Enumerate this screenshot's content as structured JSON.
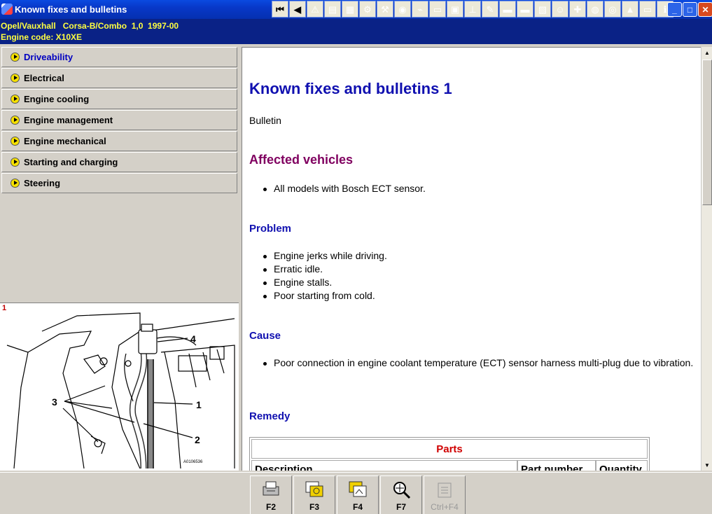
{
  "window": {
    "title": "Known fixes and bulletins",
    "controls": {
      "minimize": "_",
      "maximize": "□",
      "close": "✕"
    }
  },
  "toolbar": {
    "buttons": [
      {
        "name": "first-record-icon",
        "glyph": "⏮"
      },
      {
        "name": "previous-icon",
        "glyph": "◀"
      },
      {
        "name": "warning-icon",
        "glyph": "⚠"
      },
      {
        "name": "document-icon",
        "glyph": "▤"
      },
      {
        "name": "map-icon",
        "glyph": "▦"
      },
      {
        "name": "engine-icon",
        "glyph": "⚙"
      },
      {
        "name": "tools-icon",
        "glyph": "⚒"
      },
      {
        "name": "gauge-icon",
        "glyph": "◉"
      },
      {
        "name": "wiring-icon",
        "glyph": "⌁"
      },
      {
        "name": "car-icon",
        "glyph": "▭"
      },
      {
        "name": "garage-icon",
        "glyph": "▣"
      },
      {
        "name": "lift-icon",
        "glyph": "⊥"
      },
      {
        "name": "repair-icon",
        "glyph": "✎"
      },
      {
        "name": "car-service-icon",
        "glyph": "▬"
      },
      {
        "name": "car-green-icon",
        "glyph": "▬"
      },
      {
        "name": "bulletin-icon",
        "glyph": "▧"
      },
      {
        "name": "smiley-icon",
        "glyph": "☺"
      },
      {
        "name": "diagnostic-icon",
        "glyph": "✚"
      },
      {
        "name": "globe-icon",
        "glyph": "◍"
      },
      {
        "name": "tyre-icon",
        "glyph": "◎"
      },
      {
        "name": "road-sign-icon",
        "glyph": "▲"
      },
      {
        "name": "bus-icon",
        "glyph": "▭"
      },
      {
        "name": "info-icon",
        "glyph": "ℹ"
      }
    ]
  },
  "vehicle": {
    "line1": "Opel/Vauxhall   Corsa-B/Combo  1,0  1997-00",
    "line2": "Engine code: X10XE"
  },
  "nav": {
    "items": [
      {
        "label": "Driveability",
        "active": true
      },
      {
        "label": "Electrical",
        "active": false
      },
      {
        "label": "Engine cooling",
        "active": false
      },
      {
        "label": "Engine management",
        "active": false
      },
      {
        "label": "Engine mechanical",
        "active": false
      },
      {
        "label": "Starting and charging",
        "active": false
      },
      {
        "label": "Steering",
        "active": false
      }
    ]
  },
  "figure": {
    "number": "1",
    "callouts": [
      "1",
      "2",
      "3",
      "4"
    ],
    "reference": "A0106536"
  },
  "document": {
    "title": "Known fixes and bulletins 1",
    "type": "Bulletin",
    "affected_heading": "Affected vehicles",
    "affected_items": [
      "All models with Bosch ECT sensor."
    ],
    "problem_heading": "Problem",
    "problem_items": [
      "Engine jerks while driving.",
      "Erratic idle.",
      "Engine stalls.",
      "Poor starting from cold."
    ],
    "cause_heading": "Cause",
    "cause_items": [
      "Poor connection in engine coolant temperature (ECT) sensor harness multi-plug due to vibration."
    ],
    "remedy_heading": "Remedy",
    "parts_table": {
      "title": "Parts",
      "columns": [
        "Description",
        "Part number",
        "Quantity"
      ]
    }
  },
  "function_keys": [
    {
      "label": "F2",
      "name": "print",
      "enabled": true
    },
    {
      "label": "F3",
      "name": "copy-image",
      "enabled": true
    },
    {
      "label": "F4",
      "name": "view-images",
      "enabled": true
    },
    {
      "label": "F7",
      "name": "zoom",
      "enabled": true
    },
    {
      "label": "Ctrl+F4",
      "name": "notes",
      "enabled": false
    }
  ],
  "colors": {
    "title_bar": "#0838c8",
    "vehicle_header_bg": "#0a2286",
    "vehicle_header_text": "#ffff40",
    "doc_title": "#1010b0",
    "affected_heading": "#800060",
    "parts_heading": "#d00000",
    "panel": "#d4d0c8"
  }
}
